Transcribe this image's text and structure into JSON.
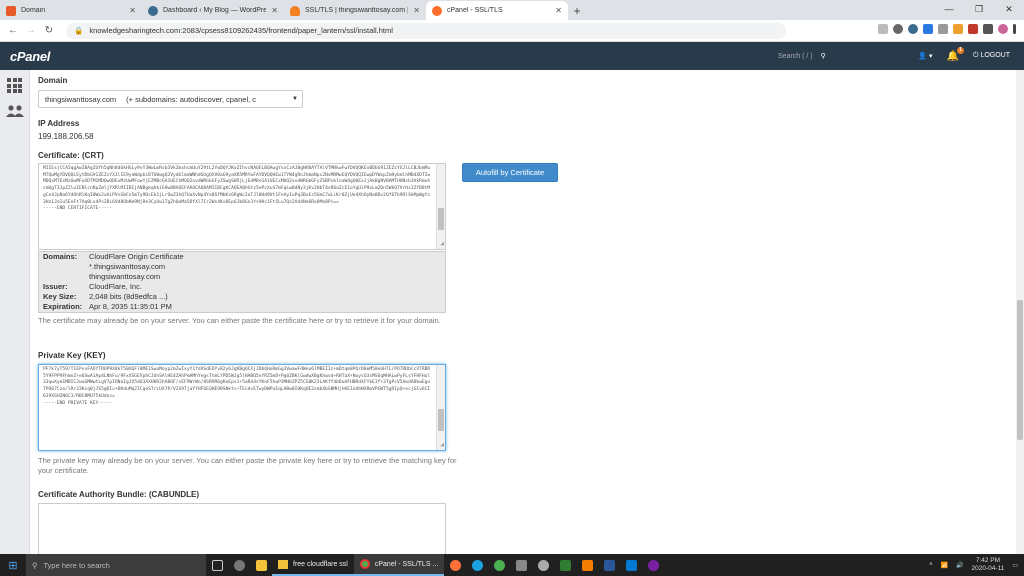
{
  "browser": {
    "tabs": [
      {
        "title": "Domain",
        "color": "#e8592a"
      },
      {
        "title": "Dashboard ‹ My Blog — WordPress",
        "color": "#3b6c8e"
      },
      {
        "title": "SSL/TLS | thingsiwanttosay.com | A",
        "color": "#f48120"
      },
      {
        "title": "cPanel - SSL/TLS",
        "color": "#ff6c2c"
      }
    ],
    "url": "knowledgesharingtech.com:2083/cpsess8109262435/frontend/paper_lantern/ssl/install.html"
  },
  "cpanel": {
    "logo": "cPanel",
    "search_placeholder": "Search ( / )",
    "notification_count": "1",
    "logout": "LOGOUT"
  },
  "form": {
    "domain_label": "Domain",
    "domain_value": "thingsiwanttosay.com",
    "domain_subdomains": "(+ subdomains: autodiscover, cpanel, c",
    "ip_label": "IP Address",
    "ip_value": "199.188.206.58",
    "crt_label": "Certificate: (CRT)",
    "crt_text": "MIIEsjCCA5qgAwIBAgIUYh5qNh8d6kHGLy9vY3WwLmRsb3VkZmxhcmUuY29tL2YwDQYJKoZIhvcNAQELBQAwgYsxCzAJBgNVBAYTAlVTMRkwFwYDVQQKExBDbG91ZEZsYXJlLCBJbmMuMTQwMgYDVQQLEytDbG91ZEZsYXJlIE9yaWdpbiBTU0wgQ2VydGlmaWNhdGUgQXV0aG9yaXR5MRYwFAYDVQQHEw1TYW4gRnJhbmNpc2NvMRMwEQYDVQQIEwpDYWxpZm9ybmlhMB4XDTIwMDQxMTExMzUwMFoXDTM1MDQwODExMzUwMFowYjEZMBcGA1UEChMQQ2xvdWRGbGFyZSwgSW5jLjEdMBsGA1UECxMUQ2xvdWRGbGFyZSBPcmlnaW4gQ0ExJjAkBgNVBAMTHUNsb3VkRmxhcmUgT3JpZ2luIENlcnRpZmljYXRlMIIBIjANBgkqhkiG9w0BAQEFAAOCAQ8AMIIBCgKCAQEA0hGtz5ePcXuS7mFqLw8dNy3jKv2HbT4sR6aZcE1oYgUiP9xLm2Dn5WkQ7VrHs3ZfB8tMgCe4JpNa6YdOhRlKqI0Wx2uAiPVsGbFn5mTy9DcEk1jLrOwZ3hQ7UaXvNp4Ye8SfMbKz6RgWc2oTJl0Hd9Vt1FnAyIuPq3BxEs5GmC7wLiKr0ZjUe4XhOyNa8Dv2Qf6Tb9RlSkMpWgYc3Hz1JoIu5EnFt7Aq0Lx4Ps2Bi6Vd8ObKm9NjRe3CyUw1TgZhQoMa5DfXl7Ir2Ws4Kv0Ep6Jb8Gn3Ys9Hc1Ft5Lu7Qz2Ad4Ne6Rx0Mo8Pi==\n-----END CERTIFICATE-----",
    "cert_details": [
      {
        "key": "Domains:",
        "lines": [
          "CloudFlare Origin Certificate",
          "*.thingsiwanttosay.com",
          "thingsiwanttosay.com"
        ]
      },
      {
        "key": "Issuer:",
        "lines": [
          "CloudFlare, Inc."
        ]
      },
      {
        "key": "Key Size:",
        "lines": [
          "2,048 bits (8d9edfca ...)"
        ]
      },
      {
        "key": "Expiration:",
        "lines": [
          "Apr 8, 2035 11:35:01 PM"
        ]
      }
    ],
    "crt_help": "The certificate may already be on your server. You can either paste the certificate here or try to retrieve it for your domain.",
    "autofill_button": "Autofill by Certificate",
    "key_label": "Private Key (KEY)",
    "key_text": "PF7k7yT59/T1EPvvFAOYTRUP9X8kT50XQFl0ME1SwuMoyp2m2wIxyY1fdXSdEOYv82y6JgKBgQCXjJDbQHoRmGg3VwawFdWeu6lMBEIIz+mDtqm8PQrD8eM58eGH7L/PO7RDbCcXTRBR5Y9FPP9FhmnZ+e6SwA1Ap4LNhFu/9FxXSGEVphCJUnSAlHE4ZAhPmAMhYegsTtmLYPD5WJg5lHABQ5nYRZ5mD+Pg0ZBKlGwdwXBgKhwvd+RHTaX+NuysQ3sMSOqMHALwPyFLsYFHFHul33qwXym1MBIC2waSMWwtLgV7pIONaIgJV5dO3AXUKR2hABOF/sEF9WrWn/8SR9R6gKeEps1+5aR44sYKnF5hwP3MHbZPZ5CG8KZ3LAKff4bDuAFHBRdXFYkE3f+3TgPcV5AodADbwEguTPO67Cze/lRr23Kcq0jJS5gDIv+DKduMq2ICgeSTrLUX7P/V2S9TjaYYHFOEQHE9BSNktc+TEcdvETwyDWPuEqLHBw0IOKqOE2xmbXbSBMHjhKE1oVbNXRmVPGWT5gRIpQ+ecjGIv6CI6J9XSH2N6C3/RBC8MU75kUdnc=\n-----END PRIVATE KEY-----",
    "key_help": "The private key may already be on your server. You can either paste the private key here or try to retrieve the matching key for your certificate.",
    "cabundle_label": "Certificate Authority Bundle: (CABUNDLE)"
  },
  "taskbar": {
    "search_placeholder": "Type here to search",
    "item1": "free cloudflare ssl",
    "item2": "cPanel - SSL/TLS ...",
    "time": "7:42 PM",
    "date": "2020-04-11"
  }
}
